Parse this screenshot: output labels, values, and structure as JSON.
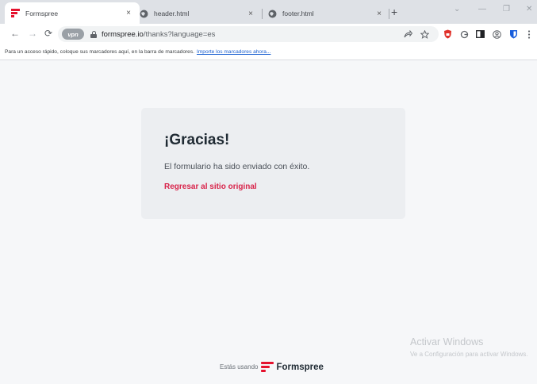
{
  "browser": {
    "tabs": [
      {
        "label": "Formspree",
        "icon": "formspree-favicon",
        "active": true
      },
      {
        "label": "header.html",
        "icon": "globe-icon",
        "active": false
      },
      {
        "label": "footer.html",
        "icon": "globe-icon",
        "active": false
      }
    ],
    "tab_close_glyph": "×",
    "new_tab_glyph": "+",
    "window_controls": {
      "collapse": "⌄",
      "minimize": "—",
      "restore": "❐",
      "close": "✕"
    },
    "nav": {
      "back": "←",
      "forward": "→",
      "reload": "⟳"
    },
    "vpn_badge": "vpn",
    "url_host": "formspree.io",
    "url_path": "/thanks?language=es",
    "toolbar_icons": [
      "share-icon",
      "star-icon",
      "shield-extension-icon",
      "extension-icon",
      "sidebar-icon",
      "profile-icon",
      "bitwarden-icon",
      "menu-icon"
    ]
  },
  "bookmarks_bar": {
    "message": "Para un acceso rápido, coloque sus marcadores aquí, en la barra de marcadores.",
    "link": "Importe los marcadores ahora..."
  },
  "page": {
    "title": "¡Gracias!",
    "message": "El formulario ha sido enviado con éxito.",
    "back_link": "Regresar al sitio original",
    "footer_prefix": "Estás usando",
    "brand": "Formspree"
  },
  "watermark": {
    "line1": "Activar Windows",
    "line2": "Ve a Configuración para activar Windows."
  },
  "colors": {
    "accent": "#d8234a",
    "brand_red": "#e5122e",
    "card_bg": "#eceef1",
    "page_bg": "#f6f7f9"
  }
}
